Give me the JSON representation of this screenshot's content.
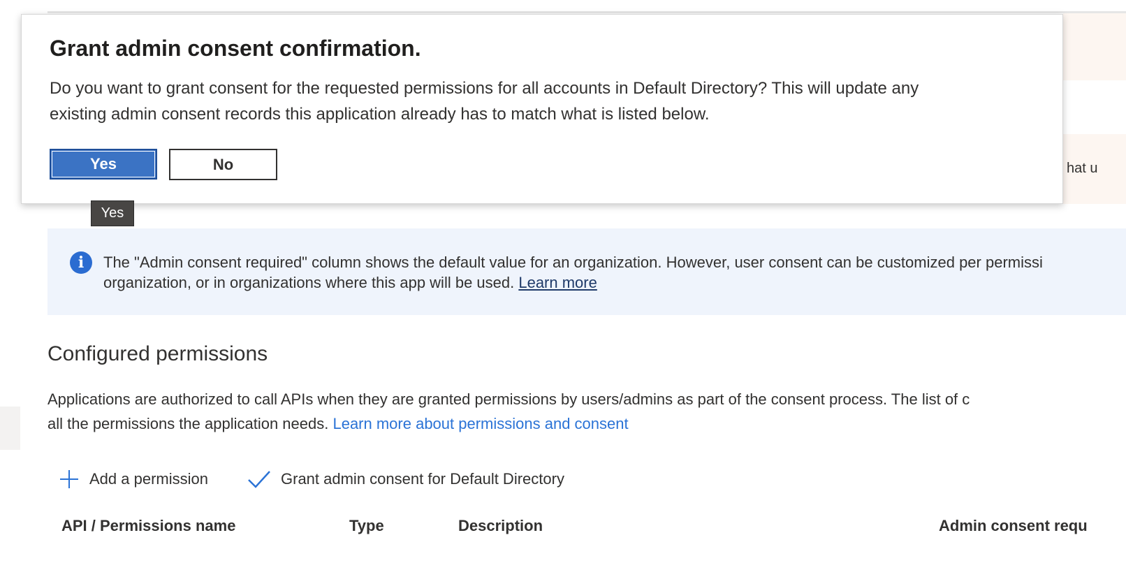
{
  "background": {
    "partial_right_text": "hat u"
  },
  "info_banner": {
    "icon": "info-icon",
    "line1": "The \"Admin consent required\" column shows the default value for an organization. However, user consent can be customized per permissi",
    "line2_text": "organization, or in organizations where this app will be used. ",
    "link": "Learn more"
  },
  "configured_permissions": {
    "title": "Configured permissions",
    "desc_line1": "Applications are authorized to call APIs when they are granted permissions by users/admins as part of the consent process. The list of c",
    "desc_line2_text": "all the permissions the application needs. ",
    "desc_link": "Learn more about permissions and consent"
  },
  "toolbar": {
    "add_permission": "Add a permission",
    "add_permission_icon": "plus-icon",
    "grant_consent": "Grant admin consent for Default Directory",
    "grant_consent_icon": "checkmark-icon"
  },
  "table": {
    "columns": [
      "API / Permissions name",
      "Type",
      "Description",
      "Admin consent requ"
    ]
  },
  "dialog": {
    "title": "Grant admin consent confirmation.",
    "body_line1": "Do you want to grant consent for the requested permissions for all accounts in Default Directory? This will update any",
    "body_line2": "existing admin consent records this application already has to match what is listed below.",
    "yes_label": "Yes",
    "no_label": "No"
  },
  "tooltip": {
    "text": "Yes"
  },
  "colors": {
    "accent": "#3b73c4",
    "link": "#2b73d6",
    "info_background": "#eff4fc",
    "info_icon": "#2b6cd1"
  }
}
